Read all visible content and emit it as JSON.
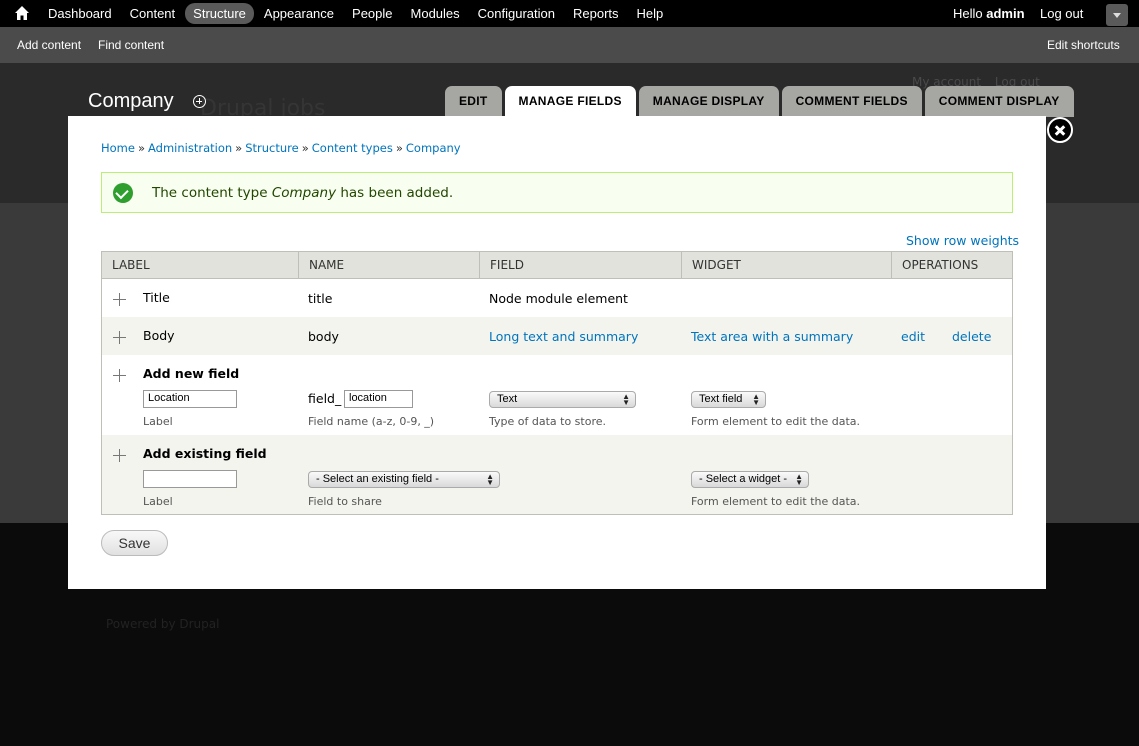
{
  "toolbar": {
    "menu": [
      {
        "label": "Dashboard",
        "active": false
      },
      {
        "label": "Content",
        "active": false
      },
      {
        "label": "Structure",
        "active": true
      },
      {
        "label": "Appearance",
        "active": false
      },
      {
        "label": "People",
        "active": false
      },
      {
        "label": "Modules",
        "active": false
      },
      {
        "label": "Configuration",
        "active": false
      },
      {
        "label": "Reports",
        "active": false
      },
      {
        "label": "Help",
        "active": false
      }
    ],
    "hello": "Hello",
    "username": "admin",
    "logout": "Log out"
  },
  "shortcuts": {
    "add_content": "Add content",
    "find_content": "Find content",
    "edit_shortcuts": "Edit shortcuts"
  },
  "background": {
    "site_name": "Drupal jobs",
    "my_account": "My account",
    "log_out": "Log out",
    "powered_by": "Powered by Drupal"
  },
  "overlay": {
    "title": "Company",
    "tabs": [
      {
        "label": "EDIT",
        "active": false
      },
      {
        "label": "MANAGE FIELDS",
        "active": true
      },
      {
        "label": "MANAGE DISPLAY",
        "active": false
      },
      {
        "label": "COMMENT FIELDS",
        "active": false
      },
      {
        "label": "COMMENT DISPLAY",
        "active": false
      }
    ]
  },
  "breadcrumb": {
    "items": [
      "Home",
      "Administration",
      "Structure",
      "Content types",
      "Company"
    ],
    "separator": "»"
  },
  "message": {
    "before": "The content type ",
    "name": "Company",
    "after": " has been added."
  },
  "show_row_weights": "Show row weights",
  "table": {
    "headers": [
      "LABEL",
      "NAME",
      "FIELD",
      "WIDGET",
      "OPERATIONS"
    ],
    "rows": [
      {
        "label": "Title",
        "name": "title",
        "field": "Node module element",
        "widget": "",
        "edit": "",
        "delete": ""
      },
      {
        "label": "Body",
        "name": "body",
        "field": "Long text and summary",
        "widget": "Text area with a summary",
        "edit": "edit",
        "delete": "delete"
      }
    ],
    "add_new": {
      "heading": "Add new field",
      "label_value": "Location",
      "label_desc": "Label",
      "name_prefix": "field_",
      "name_value": "location",
      "name_desc": "Field name (a-z, 0-9, _)",
      "type_value": "Text",
      "type_desc": "Type of data to store.",
      "widget_value": "Text field",
      "widget_desc": "Form element to edit the data."
    },
    "add_existing": {
      "heading": "Add existing field",
      "label_value": "",
      "label_desc": "Label",
      "field_value": "- Select an existing field -",
      "field_desc": "Field to share",
      "widget_value": "- Select a widget -",
      "widget_desc": "Form element to edit the data."
    }
  },
  "save_label": "Save"
}
